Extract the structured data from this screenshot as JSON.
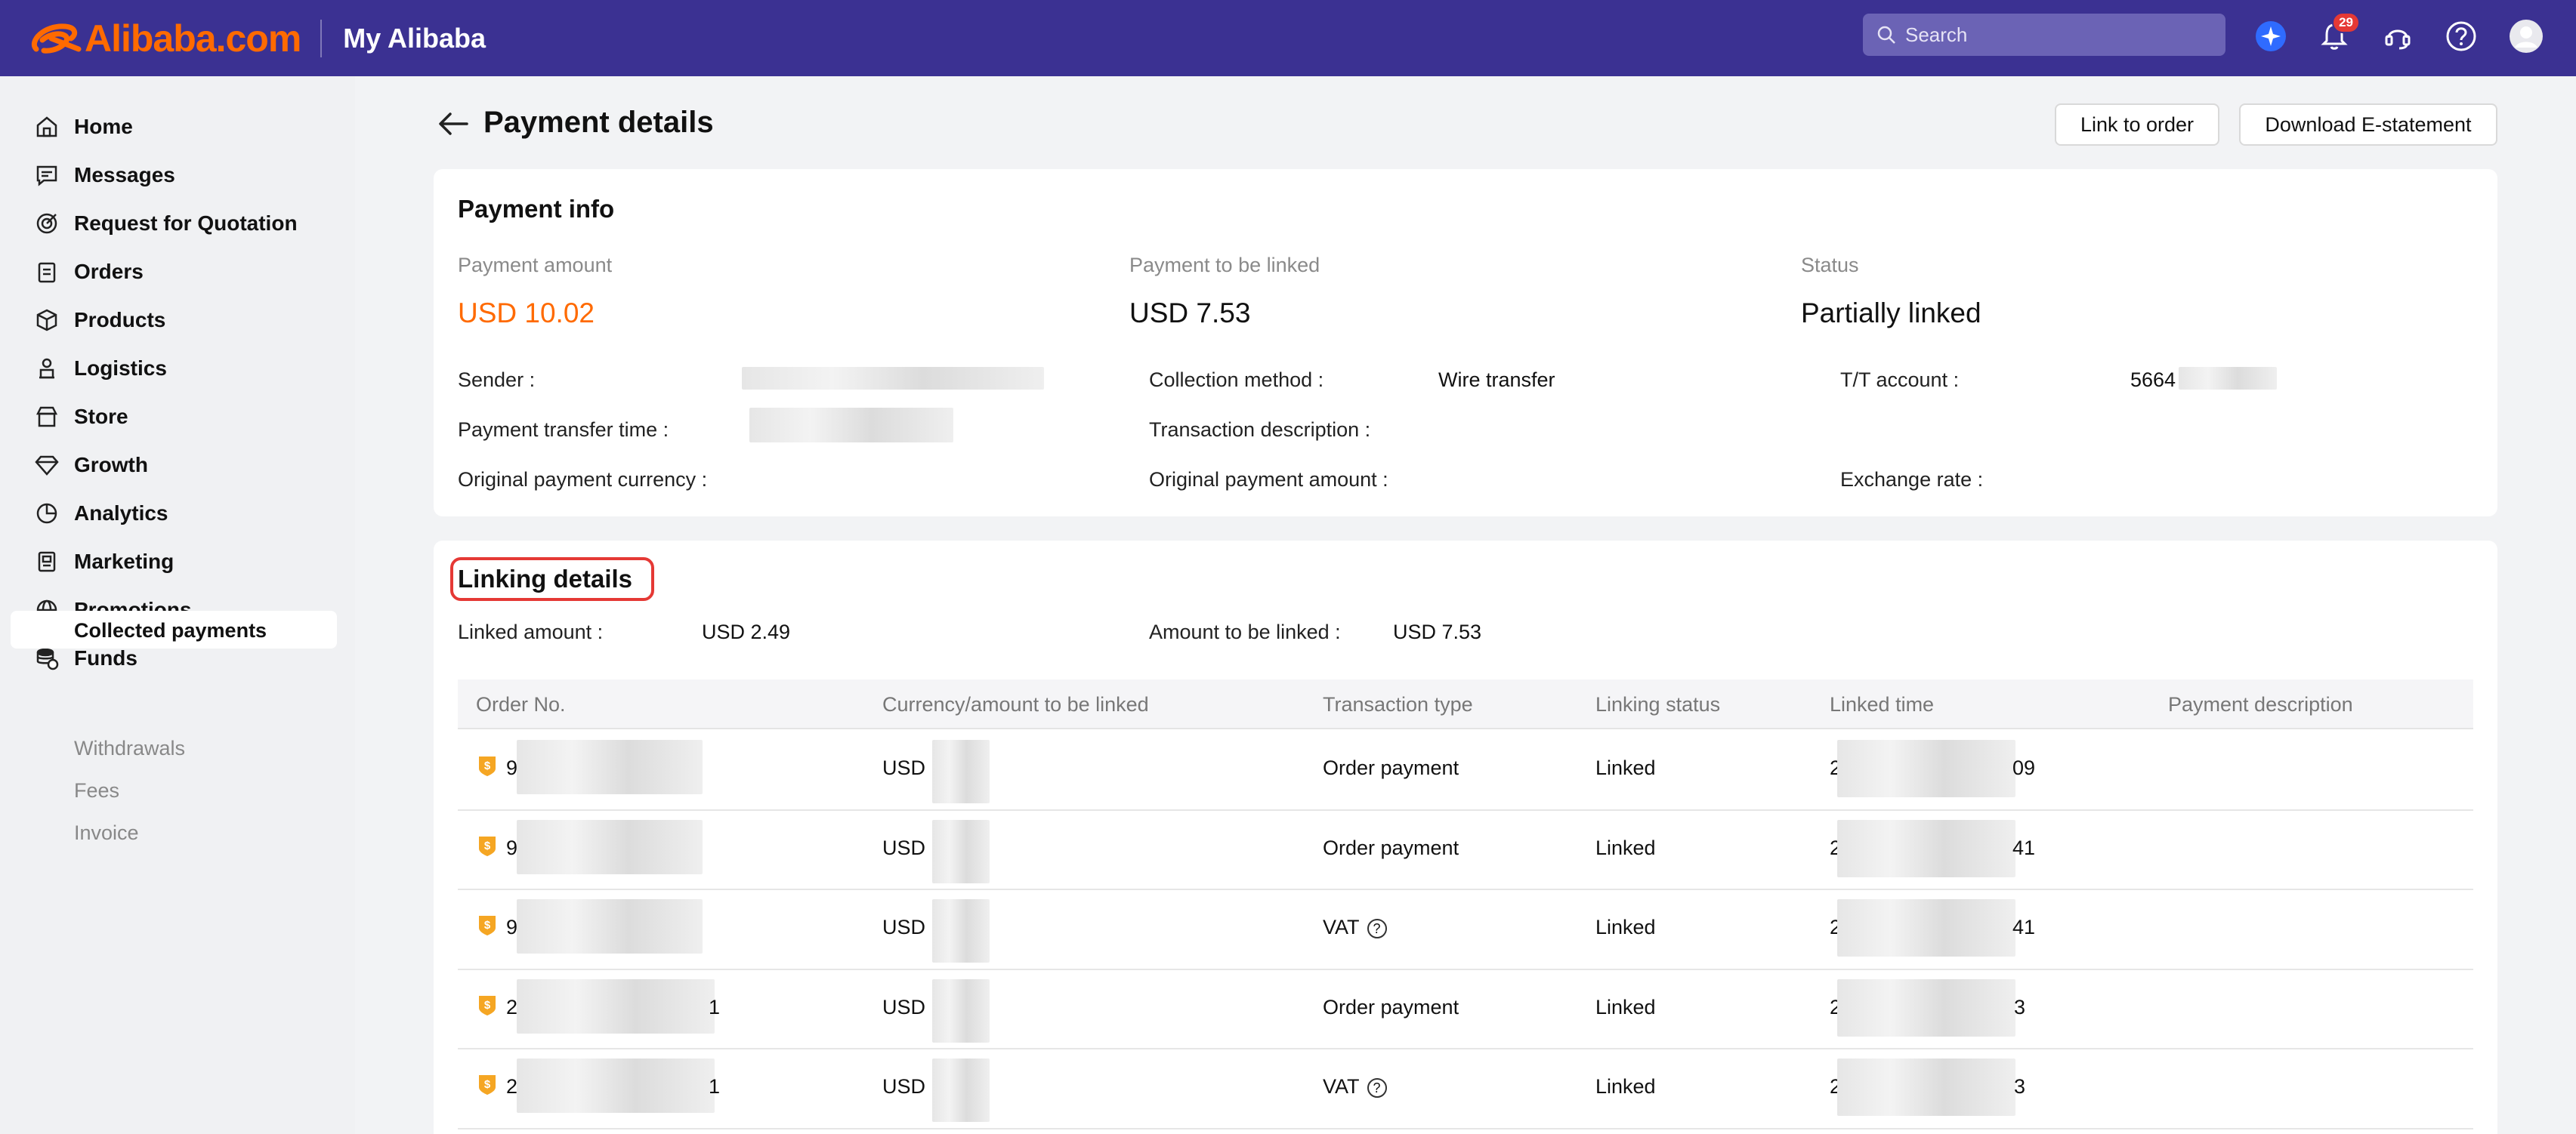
{
  "header": {
    "logo_text": "Alibaba.com",
    "section_title": "My Alibaba",
    "search_placeholder": "Search",
    "notification_count": "29",
    "accent_color": "#ff6a00",
    "bar_color": "#3b3192"
  },
  "sidebar": {
    "items": [
      {
        "label": "Home",
        "icon": "home-icon"
      },
      {
        "label": "Messages",
        "icon": "message-icon"
      },
      {
        "label": "Request for Quotation",
        "icon": "target-icon"
      },
      {
        "label": "Orders",
        "icon": "clipboard-icon"
      },
      {
        "label": "Products",
        "icon": "box-icon"
      },
      {
        "label": "Logistics",
        "icon": "truck-icon"
      },
      {
        "label": "Store",
        "icon": "store-icon"
      },
      {
        "label": "Growth",
        "icon": "diamond-icon"
      },
      {
        "label": "Analytics",
        "icon": "pie-chart-icon"
      },
      {
        "label": "Marketing",
        "icon": "marketing-icon"
      },
      {
        "label": "Promotions",
        "icon": "globe-icon"
      },
      {
        "label": "Funds",
        "icon": "coins-icon"
      }
    ],
    "sub_items": [
      "Collected payments",
      "Withdrawals",
      "Fees",
      "Invoice"
    ]
  },
  "page": {
    "title": "Payment details",
    "link_button": "Link to order",
    "download_button": "Download E-statement"
  },
  "payment_info": {
    "title": "Payment info",
    "payment_amount_label": "Payment amount",
    "payment_amount": "USD 10.02",
    "to_be_linked_label": "Payment to be linked",
    "to_be_linked": "USD 7.53",
    "status_label": "Status",
    "status": "Partially linked",
    "sender_label": "Sender",
    "collection_method_label": "Collection method",
    "collection_method": "Wire transfer",
    "tt_account_label": "T/T account",
    "tt_account_prefix": "5664",
    "transfer_time_label": "Payment transfer time",
    "transaction_desc_label": "Transaction description",
    "original_currency_label": "Original payment currency",
    "original_amount_label": "Original payment amount",
    "exchange_rate_label": "Exchange rate",
    "colon": ":"
  },
  "linking": {
    "title": "Linking details",
    "linked_amount_label": "Linked amount",
    "linked_amount": "USD 2.49",
    "amount_to_link_label": "Amount to be linked",
    "amount_to_link": "USD 7.53",
    "columns": [
      "Order No.",
      "Currency/amount to be linked",
      "Transaction type",
      "Linking status",
      "Linked time",
      "Payment description"
    ],
    "rows": [
      {
        "order_prefix": "9",
        "order_suffix": "",
        "amount": "USD (",
        "type": "Order payment",
        "status": "Linked",
        "time_prefix": "2",
        "time_suffix": "09",
        "info": false
      },
      {
        "order_prefix": "9",
        "order_suffix": "",
        "amount": "USD (",
        "type": "Order payment",
        "status": "Linked",
        "time_prefix": "2",
        "time_suffix": "41",
        "info": false
      },
      {
        "order_prefix": "9",
        "order_suffix": "",
        "amount": "USD (",
        "type": "VAT",
        "status": "Linked",
        "time_prefix": "2",
        "time_suffix": "41",
        "info": true
      },
      {
        "order_prefix": "2",
        "order_suffix": "1",
        "amount": "USD 1",
        "type": "Order payment",
        "status": "Linked",
        "time_prefix": "2",
        "time_suffix": "3",
        "info": false
      },
      {
        "order_prefix": "2",
        "order_suffix": "1",
        "amount": "USD (",
        "type": "VAT",
        "status": "Linked",
        "time_prefix": "2",
        "time_suffix": "3",
        "info": true
      }
    ]
  }
}
